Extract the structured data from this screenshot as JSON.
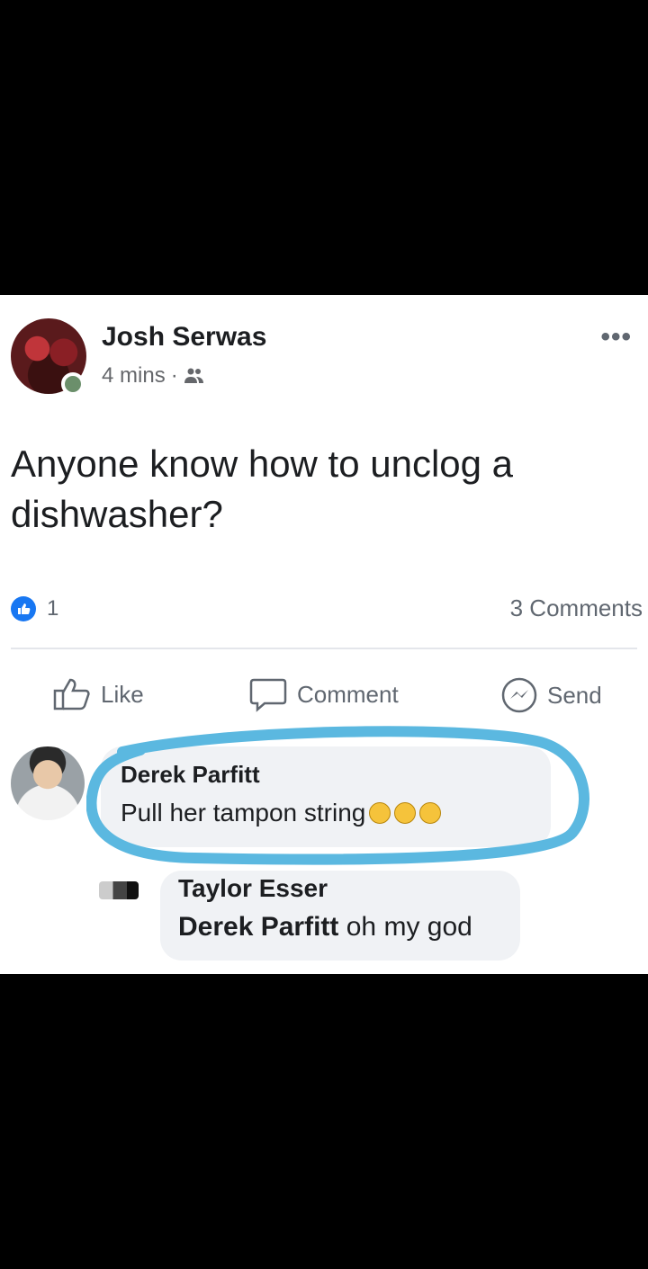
{
  "post": {
    "author": "Josh Serwas",
    "time": "4 mins",
    "audience_icon": "friends-icon",
    "text": "Anyone know how to unclog a dishwasher?",
    "reaction_count": "1",
    "comments_count": "3 Comments",
    "actions": {
      "like": "Like",
      "comment": "Comment",
      "send": "Send"
    }
  },
  "comment": {
    "author": "Derek Parfitt",
    "text": "Pull her tampon string",
    "emojis": [
      "laughing-emoji",
      "laughing-emoji",
      "laughing-emoji"
    ],
    "highlight_color": "#5bb8e0"
  },
  "reply": {
    "author": "Taylor Esser",
    "mention": "Derek Parfitt",
    "text": "oh my god"
  },
  "colors": {
    "brand": "#1877f2",
    "secondary_text": "#606770"
  }
}
